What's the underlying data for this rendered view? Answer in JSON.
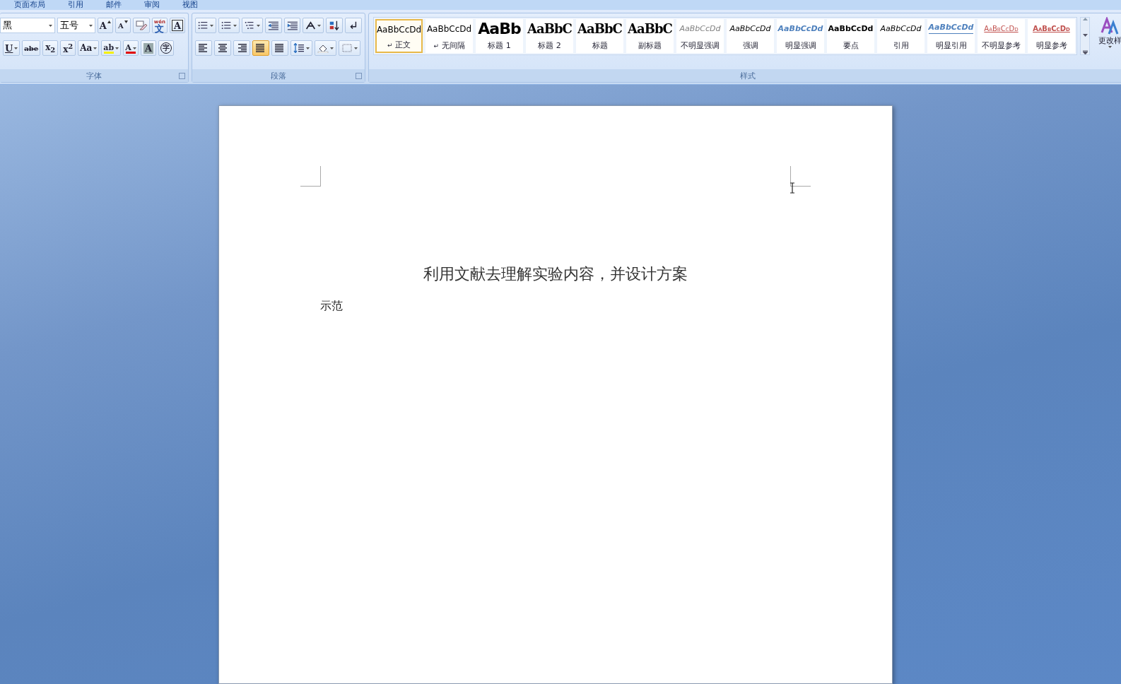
{
  "ribbon_tabs": [
    {
      "label": "页面布局",
      "selected": false
    },
    {
      "label": "引用",
      "selected": false
    },
    {
      "label": "邮件",
      "selected": false
    },
    {
      "label": "审阅",
      "selected": false
    },
    {
      "label": "视图",
      "selected": false
    }
  ],
  "font_group": {
    "title": "字体",
    "font_name": "黑",
    "font_size": "五号",
    "row1": [
      {
        "glyph": "A",
        "kind": "grow"
      },
      {
        "glyph": "A",
        "kind": "shrink"
      },
      {
        "kind": "clear"
      },
      {
        "glyph": "文",
        "ruby": "wén",
        "kind": "ruby"
      },
      {
        "glyph": "A",
        "kind": "boxed"
      }
    ],
    "row2": [
      {
        "glyph": "U",
        "kind": "underline",
        "dropdown": true
      },
      {
        "glyph": "abe",
        "kind": "strike",
        "dropdown": false
      },
      {
        "glyph": "x$_{2}$",
        "kind": "plain",
        "dropdown": false
      },
      {
        "glyph": "x$^{2}$",
        "kind": "plain",
        "dropdown": false
      },
      {
        "glyph": "Aa",
        "kind": "plain",
        "dropdown": true
      },
      {
        "glyph": "ab",
        "kind": "bar",
        "color": "#f5f000",
        "dropdown": true
      },
      {
        "glyph": "A",
        "kind": "bar",
        "color": "#e00000",
        "dropdown": true
      },
      {
        "glyph": "A",
        "kind": "shaded",
        "dropdown": false
      },
      {
        "glyph": "字",
        "kind": "circled",
        "dropdown": false
      }
    ]
  },
  "paragraph_group": {
    "title": "段落",
    "row1": [
      {
        "kind": "bullets",
        "dropdown": true
      },
      {
        "kind": "numbering",
        "dropdown": true
      },
      {
        "kind": "multilevel",
        "dropdown": true
      },
      {
        "kind": "outdent",
        "dropdown": false
      },
      {
        "kind": "indent",
        "dropdown": false
      },
      {
        "kind": "chinese-layout",
        "dropdown": true
      },
      {
        "kind": "sort",
        "dropdown": false
      },
      {
        "kind": "show-marks",
        "dropdown": false
      }
    ],
    "row2": [
      {
        "kind": "align-left",
        "selected": false
      },
      {
        "kind": "align-center",
        "selected": false
      },
      {
        "kind": "align-right",
        "selected": false
      },
      {
        "kind": "justify",
        "selected": true
      },
      {
        "kind": "distributed",
        "selected": false
      },
      {
        "kind": "line-spacing",
        "selected": false
      },
      {
        "kind": "shading",
        "selected": false
      },
      {
        "kind": "borders",
        "selected": false
      }
    ]
  },
  "styles_group": {
    "title": "样式",
    "change_styles": "更改样",
    "styles": [
      {
        "sample": "AaBbCcDd",
        "label": "正文",
        "mark": "↵",
        "kind": "normal",
        "selected": true
      },
      {
        "sample": "AaBbCcDd",
        "label": "无间隔",
        "mark": "↵",
        "kind": "normal",
        "selected": false
      },
      {
        "sample": "AaBb",
        "label": "标题 1",
        "kind": "heading1",
        "selected": false
      },
      {
        "sample": "AaBbC",
        "label": "标题 2",
        "kind": "heading",
        "selected": false
      },
      {
        "sample": "AaBbC",
        "label": "标题",
        "kind": "heading",
        "selected": false
      },
      {
        "sample": "AaBbC",
        "label": "副标题",
        "kind": "heading",
        "selected": false
      },
      {
        "sample": "AaBbCcDd",
        "label": "不明显强调",
        "kind": "italic",
        "color": "#808080",
        "selected": false
      },
      {
        "sample": "AaBbCcDd",
        "label": "强调",
        "kind": "italic",
        "color": "#000000",
        "selected": false
      },
      {
        "sample": "AaBbCcDd",
        "label": "明显强调",
        "kind": "italic-bold",
        "color": "#4f81bd",
        "selected": false
      },
      {
        "sample": "AaBbCcDd",
        "label": "要点",
        "kind": "bold",
        "color": "#000000",
        "selected": false
      },
      {
        "sample": "AaBbCcDd",
        "label": "引用",
        "kind": "italic",
        "color": "#000000",
        "selected": false
      },
      {
        "sample": "AaBbCcDd",
        "label": "明显引用",
        "kind": "underlined-bold",
        "color": "#4f81bd",
        "selected": false
      },
      {
        "sample": "AaBbCcDd",
        "label": "不明显参考",
        "kind": "smallcaps",
        "color": "#c0504d",
        "selected": false
      },
      {
        "sample": "AaBbCcDd",
        "label": "明显参考",
        "kind": "smallcaps-bold",
        "color": "#c0504d",
        "selected": false
      }
    ]
  },
  "document": {
    "title": "利用文献去理解实验内容，并设计方案",
    "body": "示范"
  }
}
